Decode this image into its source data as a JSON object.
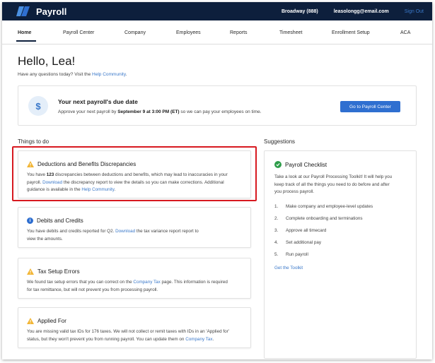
{
  "header": {
    "brand": "Payroll",
    "company": "Broadway (888)",
    "email": "leasolongg@email.com",
    "sign_out": "Sign Out"
  },
  "nav": {
    "items": [
      {
        "label": "Home",
        "active": true
      },
      {
        "label": "Payroll Center"
      },
      {
        "label": "Company"
      },
      {
        "label": "Employees"
      },
      {
        "label": "Reports"
      },
      {
        "label": "Timesheet"
      },
      {
        "label": "Enrollment Setup"
      },
      {
        "label": "ACA"
      }
    ]
  },
  "greeting": {
    "title": "Hello, Lea!",
    "question": "Have any questions today? Visit the ",
    "link": "Help Community",
    "end": "."
  },
  "due": {
    "icon": "dollar-icon",
    "title": "Your next payroll's due date",
    "text_1": "Approve your next payroll by ",
    "text_bold": "September 9 at 3:00 PM (ET)",
    "text_2": " so we can pay your employees on time.",
    "button": "Go to Payroll Center"
  },
  "things": {
    "title": "Things to do",
    "cards": [
      {
        "title": "Deductions and Benefits Discrepancies",
        "icon": "warning-icon",
        "l1a": "You have ",
        "l1b": "123",
        "l1c": " discrepancies between deductions and benefits, which may lead to inaccuracies in your",
        "l2a": "payroll. ",
        "l2link": "Download",
        "l2b": " the discrepancy report to view the details so you can make corrections. Additional",
        "l3a": "guidance is available in the ",
        "l3link": "Help Community",
        "l3b": "."
      },
      {
        "title": "Debits and Credits",
        "icon": "info-icon",
        "l1a": "You have debits and credits reported for Q2. ",
        "l1link": "Download",
        "l1b": " the tax variance report report to",
        "l2": "view the amounts."
      },
      {
        "title": "Tax Setup Errors",
        "icon": "warning-icon",
        "l1a": "We found tax setup errors that you can correct on the ",
        "l1link": "Company Tax",
        "l1b": " page. This information is required",
        "l2": "for tax remittance, but will not prevent you from processing payroll."
      },
      {
        "title": "Applied For",
        "icon": "warning-icon",
        "l1": "You are missing valid tax IDs for 176 taxes. We will not collect or remit taxes with IDs in an 'Applied for'",
        "l2a": "status, but they won't prevent you from running payroll. You can update them on ",
        "l2link": "Company Tax",
        "l2b": "."
      }
    ]
  },
  "suggestions": {
    "title": "Suggestions",
    "card_title": "Payroll Checklist",
    "icon": "check-icon",
    "desc_1": "Take a look at our Payroll Processing Toolkit! It will help you",
    "desc_2": "keep track of all the things you need to do before and after",
    "desc_3": "you process payroll.",
    "steps": [
      {
        "num": "1.",
        "label": "Make company and employee-level updates"
      },
      {
        "num": "2.",
        "label": "Complete onboarding and terminations"
      },
      {
        "num": "3.",
        "label": "Approve all timecard"
      },
      {
        "num": "4.",
        "label": "Set additional pay"
      },
      {
        "num": "5.",
        "label": "Run payroll"
      }
    ],
    "toolkit_link": "Get the Toolkit"
  },
  "colors": {
    "header_bg": "#0d1f3c",
    "accent": "#2f6fd0",
    "link": "#3a78c9",
    "warning": "#f2b534",
    "success": "#2e9d4a",
    "highlight": "#d71920"
  }
}
